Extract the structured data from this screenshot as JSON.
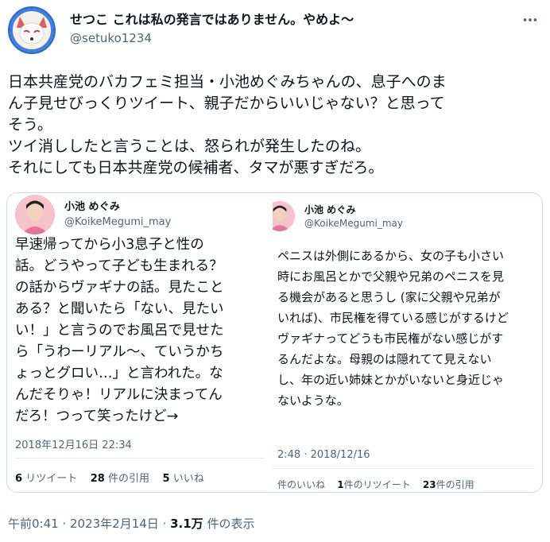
{
  "author": {
    "display_name": "せつこ これは私の発言ではありません。やめよ〜",
    "handle": "@setuko1234"
  },
  "tweet_text": "日本共産党のバカフェミ担当・小池めぐみちゃんの、息子へのま\nん子見せびっくりツイート、親子だからいいじゃない？と思って\nそう。\nツイ消ししたと言うことは、怒られが発生したのね。\nそれにしても日本共産党の候補者、タマが悪すぎだろ。",
  "left_card": {
    "name": "小池 めぐみ",
    "handle": "@KoikeMegumi_may",
    "body": "早速帰ってから小3息子と性の\n話。どうやって子ども生まれる？\nの話からヴァギナの話。見たこと\nある？と聞いたら「ない、見たい\nい！」と言うのでお風呂で見せた\nら「うわーリアル〜、ていうかち\nょっとグロい…」と言われた。な\nんだそりゃ！リアルに決まってん\nだろ！つって笑ったけど→",
    "date": "2018年12月16日 22:34",
    "retweets_count": "6",
    "retweets_label": "リツイート",
    "quotes_count": "28",
    "quotes_label": "件の引用",
    "likes_count": "5",
    "likes_label": "いいね"
  },
  "right_card": {
    "name": "小池 めぐみ",
    "handle": "@KoikeMegumi_may",
    "body": "ペニスは外側にあるから、女の子も小さい\n時にお風呂とかで父親や兄弟のペニスを見\nる機会があると思うし (家に父親や兄弟が\nいれば)、市民権を得ている感じがするけど\nヴァギナってどうも市民権がない感じがす\nるんだよな。母親のは隠れてて見えない\nし、年の近い姉妹とかがいないと身近じゃ\nないような。",
    "date": "2:48 · 2018/12/16",
    "likes_label": "件のいいね",
    "retweets_count": "1",
    "retweets_label": "件のリツイート",
    "quotes_count": "23",
    "quotes_label": "件の引用"
  },
  "meta": {
    "time": "午前0:41 · 2023年2月14日 · ",
    "views_count": "3.1万",
    "views_label": " 件の表示"
  },
  "icons": {
    "more": "more-horizontal-icon",
    "avatar": "fox-mask-avatar"
  },
  "colors": {
    "text": "#0f1419",
    "secondary": "#536471",
    "border": "#cfd9de",
    "avatar_ring": "#2a6fd6"
  }
}
